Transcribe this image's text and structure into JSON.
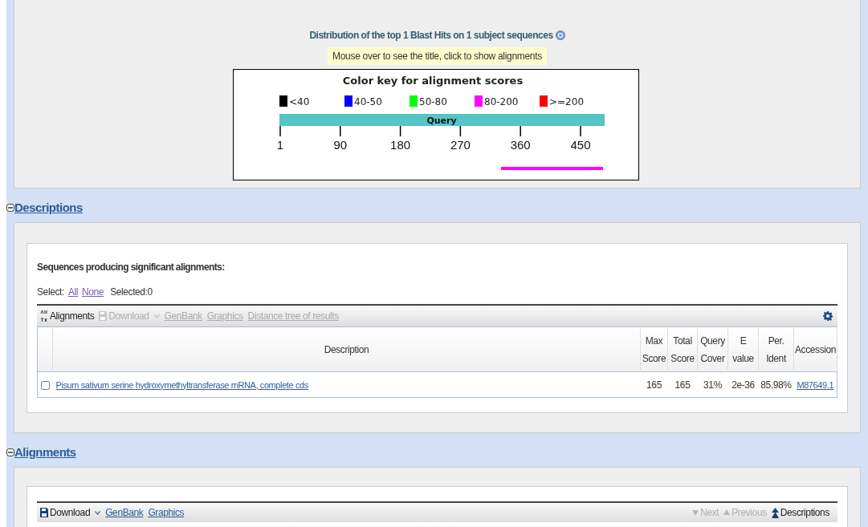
{
  "graphic": {
    "title": "Distribution of the top 1 Blast Hits on 1 subject sequences",
    "tip": "Mouse over to see the title, click to show alignments",
    "key_title": "Color key for alignment scores",
    "legend": [
      {
        "label": "<40",
        "color": "#000000"
      },
      {
        "label": "40-50",
        "color": "#0000ff"
      },
      {
        "label": "50-80",
        "color": "#00ff00"
      },
      {
        "label": "80-200",
        "color": "#ff00ff"
      },
      {
        "label": ">=200",
        "color": "#ff0000"
      }
    ],
    "query_label": "Query",
    "ticks": [
      "1",
      "90",
      "180",
      "270",
      "360",
      "450"
    ],
    "hits": [
      {
        "color": "#ff00ff"
      }
    ]
  },
  "descriptions": {
    "header": "Descriptions",
    "expanded": true,
    "heading": "Sequences producing significant alignments:",
    "select_label": "Select:",
    "select_links": [
      "All",
      "None"
    ],
    "selected_count": "Selected:0",
    "toolbar": [
      {
        "kind": "sort",
        "label": "Alignments",
        "disabled": false
      },
      {
        "kind": "download",
        "label": "Download",
        "disabled": true
      },
      {
        "kind": "link",
        "label": "GenBank",
        "disabled": true
      },
      {
        "kind": "link",
        "label": "Graphics",
        "disabled": true
      },
      {
        "kind": "link",
        "label": "Distance tree of results",
        "disabled": true
      }
    ],
    "table": {
      "columns": [
        "Description",
        [
          "Max",
          "Score"
        ],
        [
          "Total",
          "Score"
        ],
        [
          "Query",
          "Cover"
        ],
        [
          "E",
          "value"
        ],
        [
          "Per.",
          "Ident"
        ],
        "Accession"
      ],
      "rows": [
        {
          "checked": false,
          "cells": [
            "Pisum sativum serine hydroxymethyltransferase mRNA, complete cds",
            "165",
            "165",
            "31%",
            "2e-36",
            "85.98%",
            "M87649.1"
          ]
        }
      ]
    }
  },
  "alignments": {
    "header": "Alignments",
    "expanded": true,
    "toolbar": [
      {
        "kind": "download",
        "label": "Download",
        "disabled": false
      },
      {
        "kind": "link",
        "label": "GenBank",
        "disabled": false
      },
      {
        "kind": "link",
        "label": "Graphics",
        "disabled": false
      }
    ],
    "nav": [
      {
        "kind": "next",
        "label": "Next",
        "disabled": true
      },
      {
        "kind": "previous",
        "label": "Previous",
        "disabled": true
      },
      {
        "kind": "up",
        "label": "Descriptions",
        "disabled": false
      }
    ]
  }
}
